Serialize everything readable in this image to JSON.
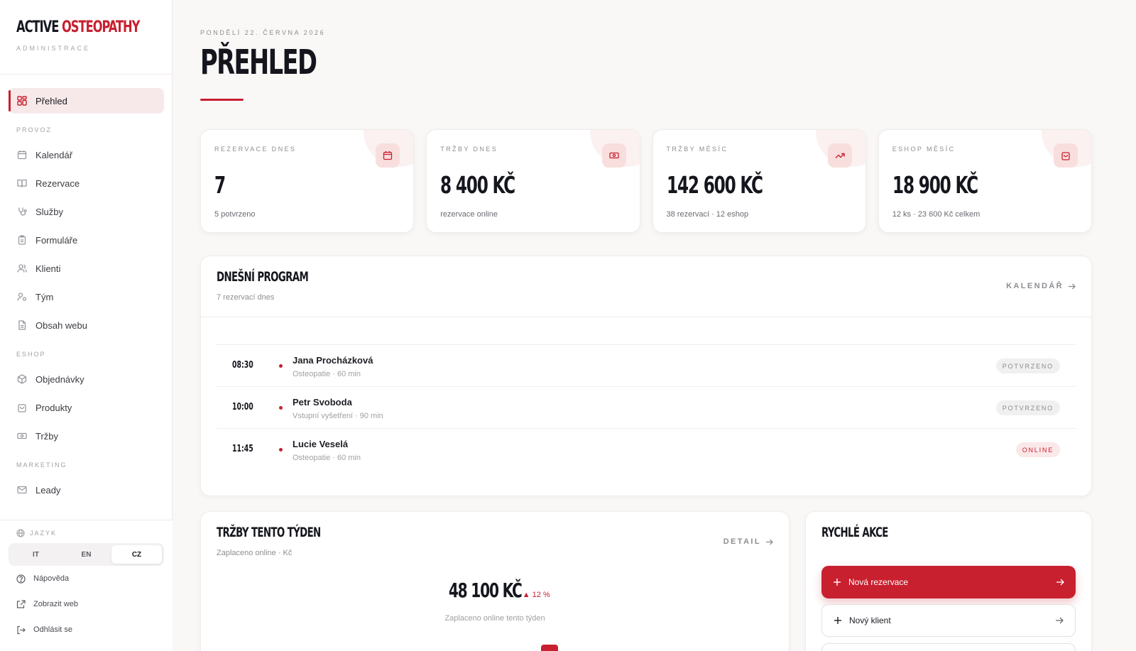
{
  "brand": {
    "name_part1": "ACTIVE",
    "name_part2": "OSTEOPATHY",
    "subtitle": "ADMINISTRACE"
  },
  "nav": {
    "overview": "Přehled",
    "section_provoz": "PROVOZ",
    "kalendar": "Kalendář",
    "rezervace": "Rezervace",
    "sluzby": "Služby",
    "formulare": "Formuláře",
    "klienti": "Klienti",
    "tym": "Tým",
    "obsah_webu": "Obsah webu",
    "section_eshop": "ESHOP",
    "objednavky": "Objednávky",
    "produkty": "Produkty",
    "trzby": "Tržby",
    "section_marketing": "MARKETING",
    "leady": "Leady"
  },
  "language": {
    "label": "JAZYK",
    "options": [
      "IT",
      "EN",
      "CZ"
    ],
    "selected": "CZ"
  },
  "footer_links": {
    "help": "Nápověda",
    "view_site": "Zobrazit web",
    "logout": "Odhlásit se"
  },
  "header": {
    "date": "PONDĚLÍ 22. ČERVNA 2026",
    "title": "PŘEHLED"
  },
  "stats": [
    {
      "label": "REZERVACE DNES",
      "value": "7",
      "sub": "5 potvrzeno",
      "icon": "calendar-icon"
    },
    {
      "label": "TRŽBY DNES",
      "value": "8 400 KČ",
      "sub": "rezervace online",
      "icon": "banknote-icon"
    },
    {
      "label": "TRŽBY MĚSÍC",
      "value": "142 600 KČ",
      "sub": "38 rezervací · 12 eshop",
      "icon": "trending-up-icon"
    },
    {
      "label": "ESHOP MĚSÍC",
      "value": "18 900 KČ",
      "sub": "12 ks · 23 600 Kč celkem",
      "icon": "shopping-bag-icon"
    }
  ],
  "program": {
    "title": "DNEŠNÍ PROGRAM",
    "subtitle": "7 rezervací dnes",
    "link": "KALENDÁŘ",
    "appointments": [
      {
        "time": "08:30",
        "name": "Jana Procházková",
        "detail": "Osteopatie · 60 min",
        "status": "POTVRZENO"
      },
      {
        "time": "10:00",
        "name": "Petr Svoboda",
        "detail": "Vstupní vyšetření · 90 min",
        "status": "POTVRZENO"
      },
      {
        "time": "11:45",
        "name": "Lucie Veselá",
        "detail": "Osteopatie · 60 min",
        "status": "ONLINE"
      }
    ]
  },
  "revenue": {
    "title": "TRŽBY TENTO TÝDEN",
    "subtitle": "Zaplaceno online · Kč",
    "link": "DETAIL",
    "total": "48 100 KČ",
    "trend": "▲ 12 %",
    "caption": "Zaplaceno online tento týden"
  },
  "quick_actions": {
    "title": "RYCHLÉ AKCE",
    "new_reservation": "Nová rezervace",
    "new_client": "Nový klient"
  },
  "colors": {
    "accent": "#c8202f",
    "accent_soft": "#f9dede",
    "background": "#faf7f7"
  }
}
